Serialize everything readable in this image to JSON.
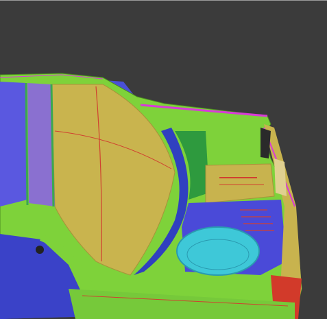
{
  "viewport": {
    "background": "#3b3b3b",
    "top_edge": "#9a9a9a"
  },
  "model": {
    "description_colors": {
      "body_green": "#7ed23a",
      "roof_yellow": "#c9b44e",
      "side_blue": "#4a4ad8",
      "trunk_cyan": "#3ec8d8",
      "edge_red": "#d23a2a",
      "edge_magenta": "#d83ad8",
      "panel_olive": "#b8b438"
    }
  }
}
